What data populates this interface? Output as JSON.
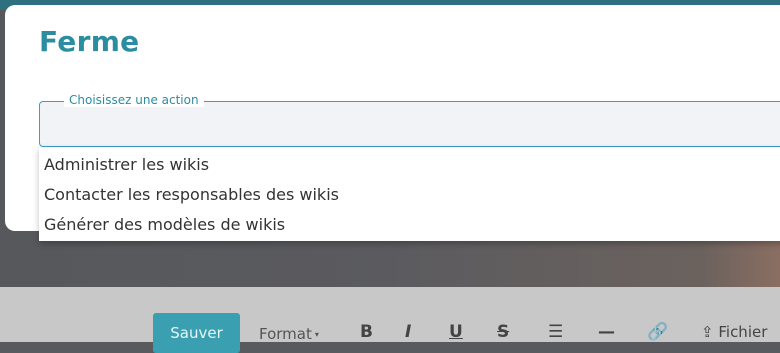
{
  "modal": {
    "title": "Ferme",
    "field_label": "Choisissez une action",
    "field_value": ""
  },
  "dropdown": {
    "items": [
      "Administrer les wikis",
      "Contacter les responsables des wikis",
      "Générer des modèles de wikis"
    ]
  },
  "toolbar": {
    "save_label": "Sauver",
    "format_label": "Format",
    "files_label": "Fichier",
    "bold_glyph": "B",
    "italic_glyph": "I",
    "underline_glyph": "U",
    "strike_glyph": "S",
    "list_glyph": "☰",
    "hr_glyph": "—",
    "link_glyph": "🔗",
    "upload_glyph": "⇪"
  }
}
